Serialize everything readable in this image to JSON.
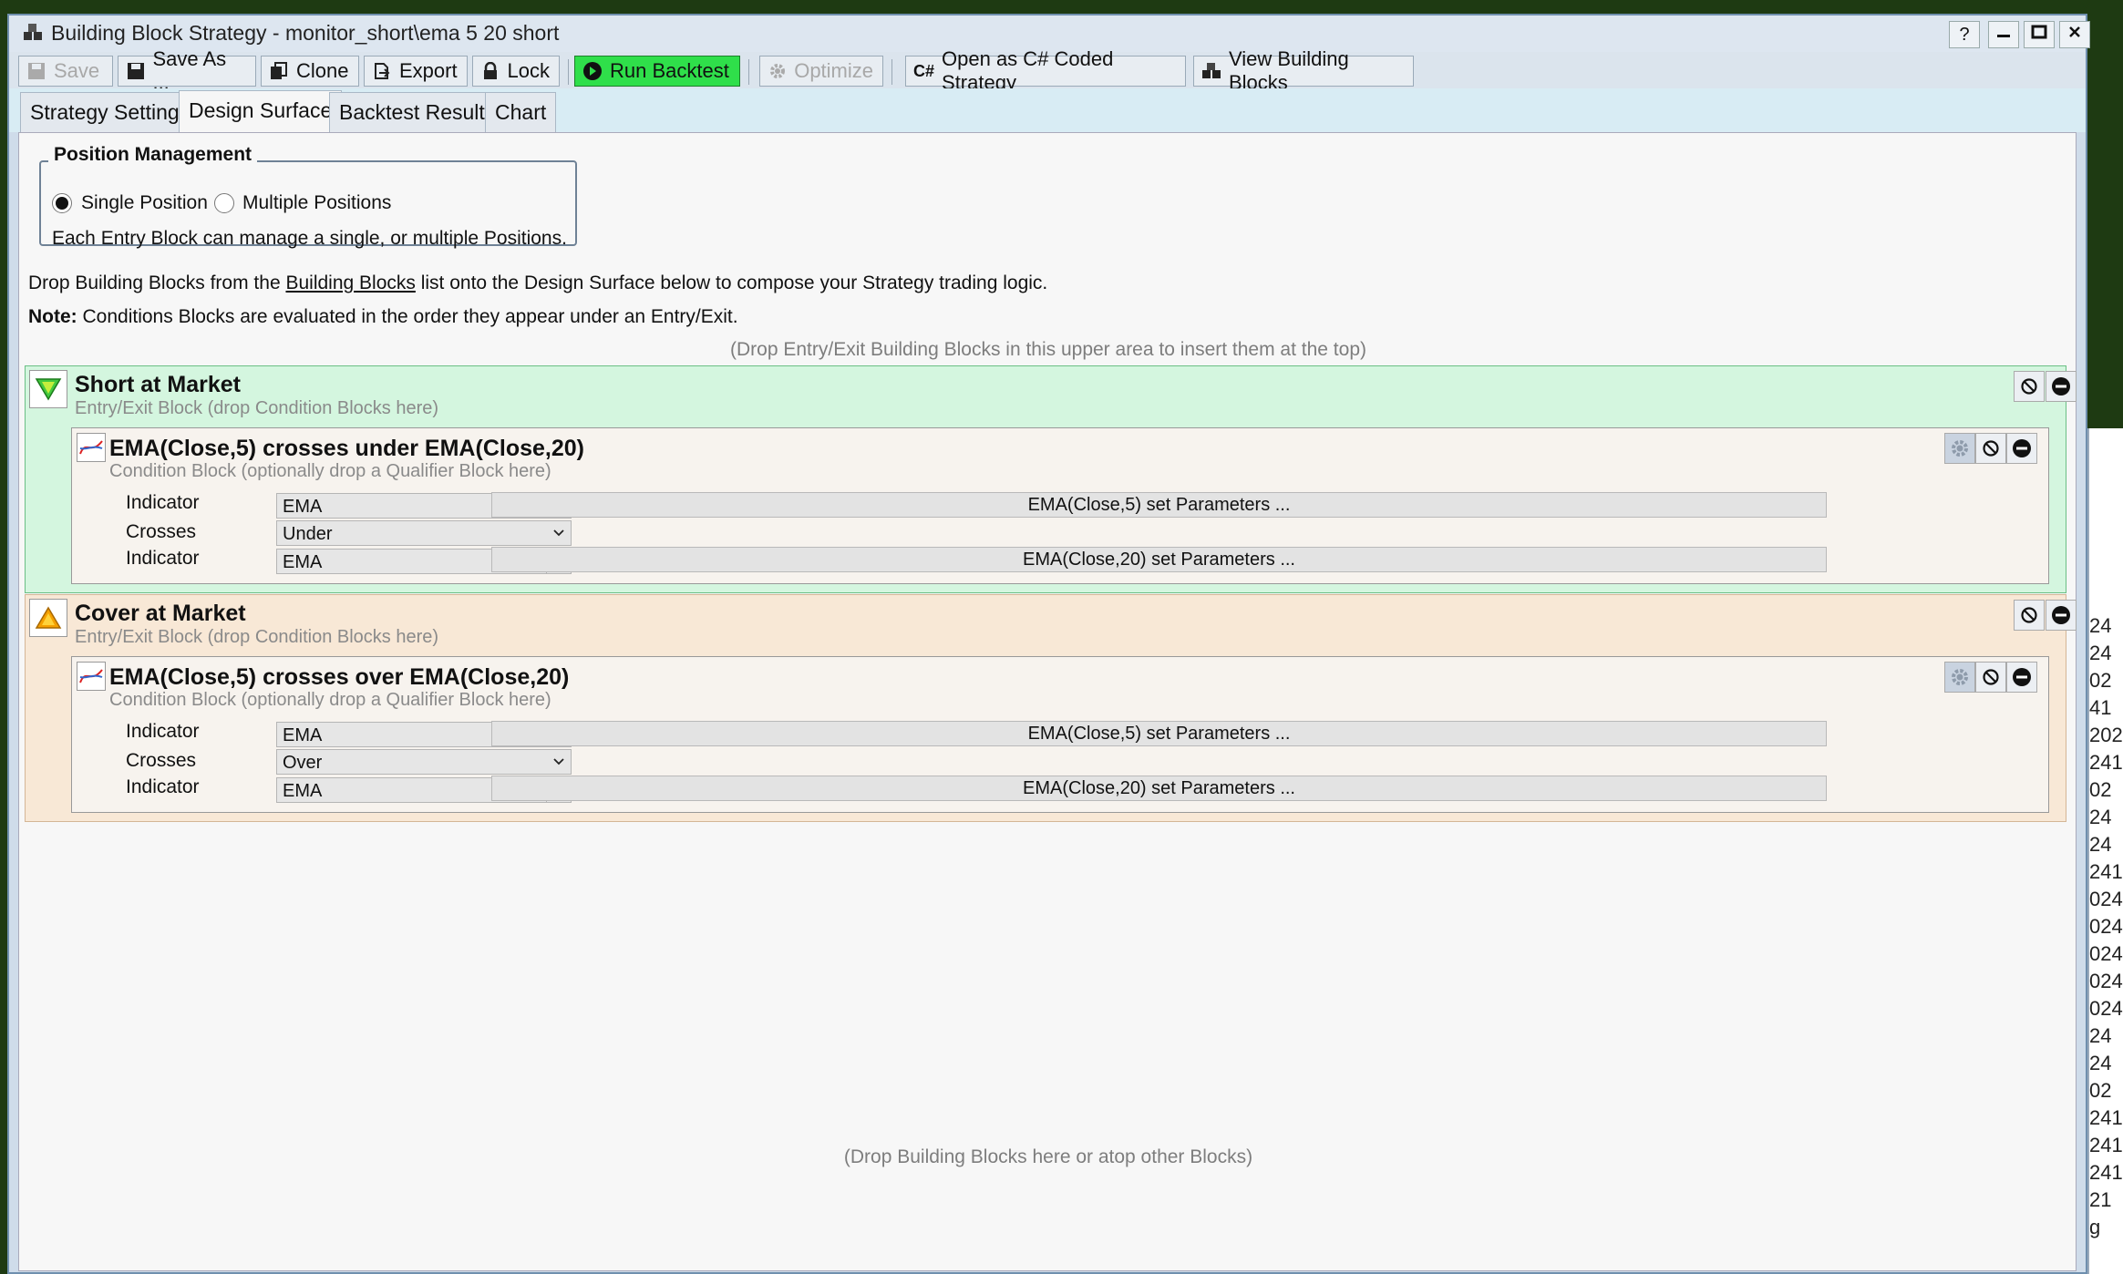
{
  "window": {
    "title": "Building Block Strategy - monitor_short\\ema 5 20 short",
    "help": "?"
  },
  "toolbar": {
    "save": "Save",
    "save_as": "Save As ...",
    "clone": "Clone",
    "export": "Export",
    "lock": "Lock",
    "run_backtest": "Run Backtest",
    "optimize": "Optimize",
    "open_csharp": "Open as C# Coded Strategy",
    "view_blocks": "View Building Blocks"
  },
  "tabs": [
    "Strategy Settings",
    "Design Surface",
    "Backtest Results",
    "Chart"
  ],
  "position_management": {
    "legend": "Position Management",
    "single": "Single Position",
    "multiple": "Multiple Positions",
    "description": "Each Entry Block can manage a single, or multiple Positions."
  },
  "instructions": {
    "line1_pre": "Drop Building Blocks from the ",
    "line1_link": "Building Blocks",
    "line1_post": " list onto the Design Surface below to compose your Strategy trading logic.",
    "note_label": "Note:",
    "note_text": " Conditions Blocks are evaluated in the order they appear under an Entry/Exit.",
    "drop_top": "(Drop Entry/Exit Building Blocks in this upper area to insert them at the top)",
    "drop_bottom": "(Drop Building Blocks here or atop other Blocks)"
  },
  "blocks": [
    {
      "title": "Short at Market",
      "subtitle": "Entry/Exit Block (drop Condition Blocks here)",
      "condition": {
        "title": "EMA(Close,5) crosses under EMA(Close,20)",
        "subtitle": "Condition Block (optionally drop a Qualifier Block here)",
        "row1_label": "Indicator",
        "row1_value": "EMA",
        "row1_param": "EMA(Close,5) set Parameters ...",
        "row2_label": "Crosses",
        "row2_value": "Under",
        "row3_label": "Indicator",
        "row3_value": "EMA",
        "row3_param": "EMA(Close,20) set Parameters ..."
      }
    },
    {
      "title": "Cover at Market",
      "subtitle": "Entry/Exit Block (drop Condition Blocks here)",
      "condition": {
        "title": "EMA(Close,5) crosses over EMA(Close,20)",
        "subtitle": "Condition Block (optionally drop a Qualifier Block here)",
        "row1_label": "Indicator",
        "row1_value": "EMA",
        "row1_param": "EMA(Close,5) set Parameters ...",
        "row2_label": "Crosses",
        "row2_value": "Over",
        "row3_label": "Indicator",
        "row3_value": "EMA",
        "row3_param": "EMA(Close,20) set Parameters ..."
      }
    }
  ],
  "background_window": {
    "fragments": [
      "24",
      "24",
      "02",
      "41",
      "202",
      "241",
      "02",
      "24",
      "24",
      "241",
      "024",
      "024",
      "024",
      "024",
      "024",
      "24",
      "24",
      "02",
      "241",
      "241",
      "241",
      "21",
      "g"
    ]
  },
  "colors": {
    "run_button": "#2fdf4a",
    "short_block_bg": "#d4f6df",
    "cover_block_bg": "#f8e8d6"
  }
}
